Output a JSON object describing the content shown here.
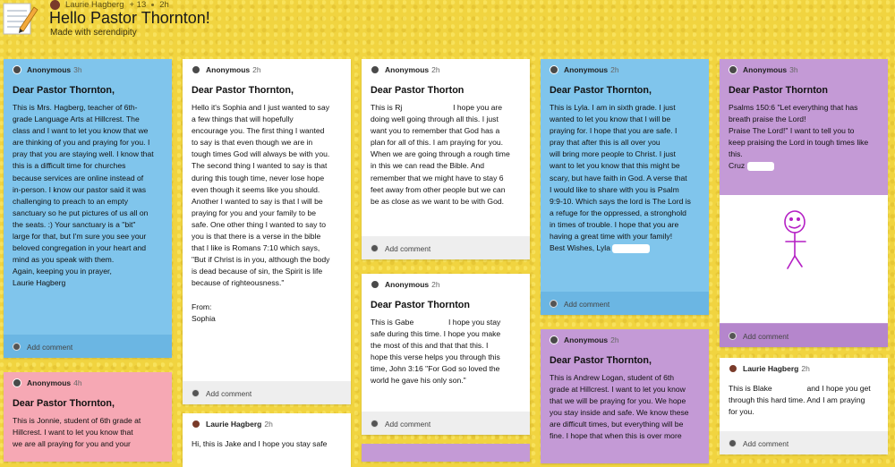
{
  "header": {
    "author": "Laurie Hagberg",
    "contributors": "+ 13",
    "time": "2h",
    "title": "Hello Pastor Thornton!",
    "subtitle": "Made with serendipity"
  },
  "add_comment_label": "Add comment",
  "cards": [
    {
      "author": "Anonymous",
      "time": "3h",
      "title": "Dear Pastor Thornton,",
      "body": "This is Mrs. Hagberg, teacher of 6th-\ngrade Language Arts at Hillcrest. The\nclass and I want to let you know that we\nare thinking of you and praying for you. I\npray that you are staying well. I know that\nthis is a difficult time for churches\nbecause services are online instead of\nin-person. I know our pastor said it was\nchallenging to preach to an empty\nsanctuary so he put pictures of us all on\nthe seats. :) Your sanctuary is a \"bit\"\nlarge for that, but I'm sure you see your\nbeloved congregation in your heart and\nmind as you speak with them.\nAgain, keeping you in prayer,\nLaurie Hagberg"
    },
    {
      "author": "Anonymous",
      "time": "4h",
      "title": "Dear Pastor Thornton,",
      "body": "This is Jonnie, student of 6th grade at\nHillcrest. I want to let you know that\nwe are all praying for you and your"
    },
    {
      "author": "Anonymous",
      "time": "2h",
      "title": "Dear Pastor Thornton,",
      "body": "Hello it's Sophia and I just wanted to say\na few things that will hopefully\nencourage you. The first thing I wanted\nto say is that even though we are in\ntough times God will always be with you.\nThe second thing I wanted to say is that\nduring this tough time, never lose hope\neven though it seems like you should.\nAnother I wanted to say is that I will be\npraying for you and your family to be\nsafe. One other thing I wanted to say to\nyou is that there is a verse in the bible\nthat I like is Romans 7:10 which says,\n\"But if Christ is in you, although the body\nis dead because of sin, the Spirit is life\nbecause of righteousness.\"\n\nFrom:\nSophia"
    },
    {
      "author": "Laurie Hagberg",
      "time": "2h",
      "title": "",
      "body": "Hi, this is Jake and I hope you stay safe"
    },
    {
      "author": "Anonymous",
      "time": "2h",
      "title": "Dear Pastor Thorton",
      "body_a": "This is Rj",
      "body_b": "I hope you are\ndoing well going through all this. I just\nwant you to remember that God has a\nplan for all of this. I am praying for you.\nWhen we are going through a rough time\nin this we can read the Bible. And\nremember that we might have to stay 6\nfeet away from other people but we can\nbe as close as we want to be with God."
    },
    {
      "author": "Anonymous",
      "time": "2h",
      "title": "Dear Pastor Thornton",
      "body_a": "This is Gabe",
      "body_b": "I hope you stay\nsafe during this time. I hope you make\nthe most  of  this and that that this. I\nhope this verse helps you through this\ntime, John 3:16  \"For God so loved the\nworld he gave his only son.\""
    },
    {
      "author": "Anonymous",
      "time": "2h",
      "title": "Dear Pastor Thornton,",
      "body": "This is Lyla. I am in sixth grade. I just\nwanted to let you know that I will be\npraying for. I hope that you are safe. I\npray that after this is all over you\nwill bring more people to Christ. I just\nwant to let you know that this might be\nscary, but have faith in God. A verse that\nI would like to share with you is  Psalm\n9:9-10. Which says the lord is The Lord is\na refuge for the oppressed, a stronghold\nin times of trouble.  I hope that you are\nhaving a great time with your family!\nBest Wishes, Lyla"
    },
    {
      "author": "Anonymous",
      "time": "2h",
      "title": "Dear Pastor Thornton,",
      "body": "This is Andrew Logan, student of 6th\ngrade at Hillcrest. I want to let you know\nthat we will be praying for you. We hope\nyou stay inside and safe. We know these\nare difficult times, but everything will be\nfine. I hope that when this is over more"
    },
    {
      "author": "Anonymous",
      "time": "3h",
      "title": "Dear Pastor Thornton",
      "body": "Psalms 150:6 \"Let everything that has\nbreath praise the Lord!\nPraise The Lord!\" I want to tell you to\nkeep praising the Lord in tough times like\nthis.\nCruz"
    },
    {
      "author": "Laurie Hagberg",
      "time": "2h",
      "title": "",
      "body_a": "This is Blake",
      "body_b": "and I hope you get\nthrough this hard time. And I am praying\nfor you."
    }
  ]
}
